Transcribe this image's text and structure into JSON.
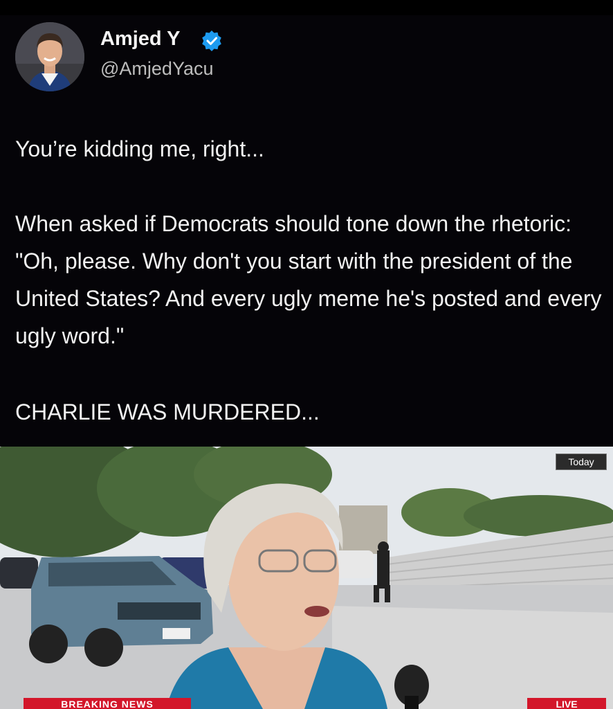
{
  "tweet": {
    "author_name": "Amjed Y",
    "author_handle": "@AmjedYacu",
    "paragraphs": [
      "You’re kidding me, right...",
      "When asked if Democrats should tone down the rhetoric: \"Oh, please. Why don't you start with the president of the United States? And every ugly meme he's posted and every ugly word.\"",
      "CHARLIE WAS MURDERED..."
    ]
  },
  "video": {
    "badge_today": "Today",
    "lower_third_left": "BREAKING NEWS",
    "lower_third_right": "LIVE"
  },
  "colors": {
    "background": "#050408",
    "verified": "#1d9bf0",
    "news_red": "#d3162a"
  },
  "icons": {
    "verified": "verified-badge-icon"
  }
}
